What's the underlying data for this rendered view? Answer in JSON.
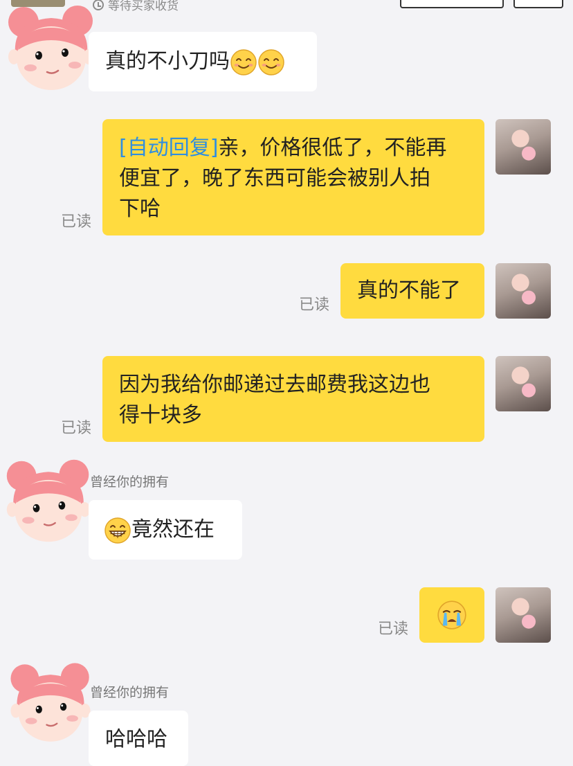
{
  "header": {
    "status_text": "等待买家收货"
  },
  "colors": {
    "background": "#f3f3f6",
    "self_bubble": "#ffdb3f",
    "other_bubble": "#ffffff",
    "auto_reply_tag": "#2f8ee0",
    "read_label": "#888888"
  },
  "messages": [
    {
      "side": "left",
      "text": "真的不小刀吗",
      "emojis": [
        "smile-emoji",
        "smile-emoji"
      ]
    },
    {
      "side": "right",
      "tag": "[自动回复]",
      "text_line1": "亲，价格很低了，不能再",
      "text_line2": "便宜了，晚了东西可能会被别人拍",
      "text_line3": "下哈",
      "read": "已读"
    },
    {
      "side": "right",
      "text": "真的不能了",
      "read": "已读"
    },
    {
      "side": "right",
      "text_line1": "因为我给你邮递过去邮费我这边也",
      "text_line2": "得十块多",
      "read": "已读"
    },
    {
      "side": "left",
      "sender": "曾经你的拥有",
      "text": "竟然还在",
      "emojis": [
        "grin-emoji"
      ]
    },
    {
      "side": "right",
      "read": "已读",
      "emojis": [
        "crying-emoji"
      ]
    },
    {
      "side": "left",
      "sender": "曾经你的拥有",
      "text": "哈哈哈"
    }
  ]
}
